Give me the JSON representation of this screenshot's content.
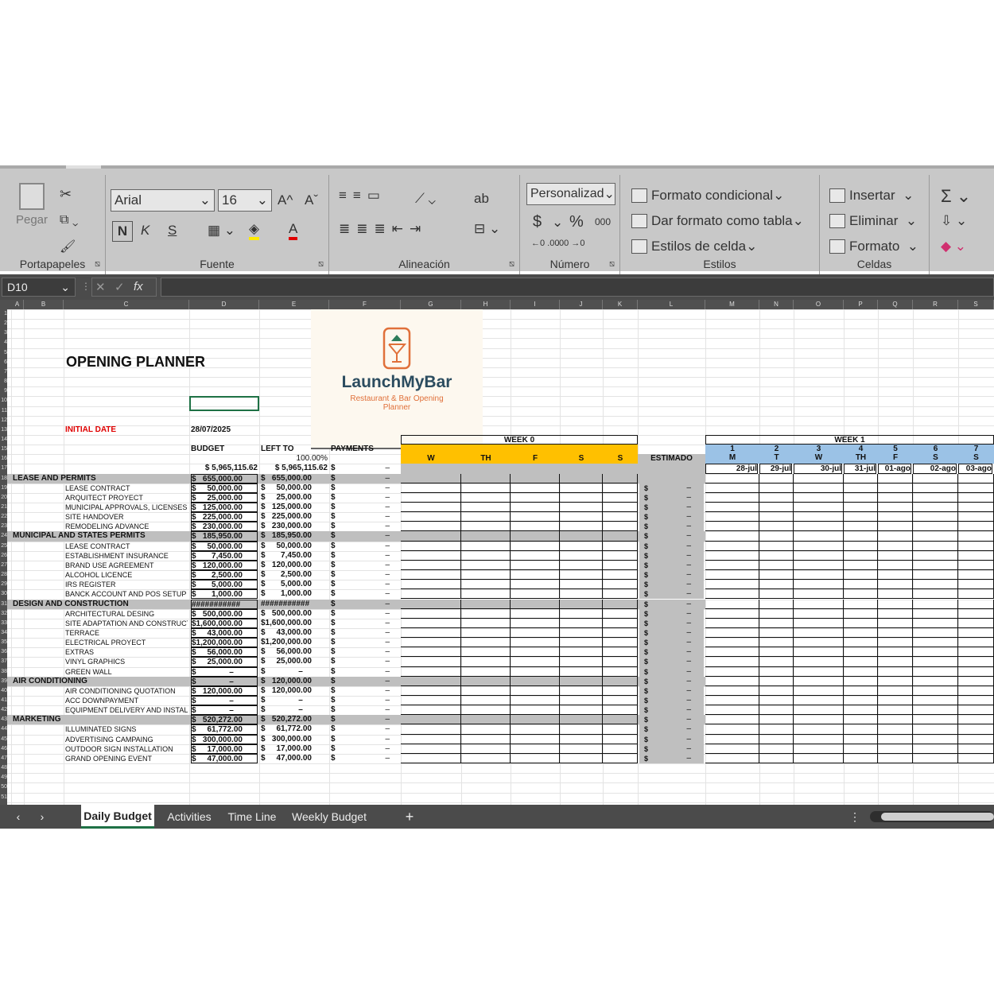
{
  "ribbon": {
    "clipboard": {
      "paste_label": "Pegar",
      "group_label": "Portapapeles"
    },
    "font": {
      "family": "Arial",
      "size": "16",
      "bold": "N",
      "italic": "K",
      "underline": "S",
      "group_label": "Fuente",
      "grow": "A^",
      "shrink": "Aˇ"
    },
    "alignment": {
      "group_label": "Alineación"
    },
    "number": {
      "format": "Personalizad",
      "currency": "$",
      "percent": "%",
      "thousands": "000",
      "inc_dec": "←0 .00",
      "dec_dec": ".00 →0",
      "group_label": "Número"
    },
    "styles": {
      "conditional": "Formato condicional",
      "as_table": "Dar formato como tabla",
      "cell_styles": "Estilos de celda",
      "group_label": "Estilos"
    },
    "cells": {
      "insert": "Insertar",
      "delete": "Eliminar",
      "format": "Formato",
      "group_label": "Celdas"
    }
  },
  "formula_bar": {
    "name_box": "D10",
    "fx": "fx",
    "value": ""
  },
  "columns": [
    "A",
    "B",
    "C",
    "D",
    "E",
    "F",
    "G",
    "H",
    "I",
    "J",
    "K",
    "L",
    "M",
    "N",
    "O",
    "P",
    "Q",
    "R",
    "S"
  ],
  "sheet": {
    "title": "OPENING PLANNER",
    "logo": {
      "name": "LaunchMyBar",
      "tagline": "Restaurant & Bar Opening Planner"
    },
    "initial_date_label": "INITIAL DATE",
    "initial_date": "28/07/2025",
    "headers": {
      "budget": "BUDGET",
      "left_to": "LEFT TO",
      "payments": "PAYMENTS",
      "percent": "100.00%",
      "estimado": "ESTIMADO"
    },
    "totals": {
      "budget": "$ 5,965,115.62",
      "left": "$ 5,965,115.62",
      "pay": "$",
      "dash": "–"
    },
    "week0": {
      "label": "WEEK 0",
      "days": [
        "W",
        "TH",
        "F",
        "S",
        "S"
      ]
    },
    "week1": {
      "label": "WEEK 1",
      "nums": [
        "1",
        "2",
        "3",
        "4",
        "5",
        "6",
        "7"
      ],
      "days": [
        "M",
        "T",
        "W",
        "TH",
        "F",
        "S",
        "S"
      ],
      "dates": [
        "28-jul",
        "29-jul",
        "30-jul",
        "31-jul",
        "01-ago",
        "02-ago",
        "03-ago"
      ]
    },
    "rows": [
      {
        "label": "LEASE AND PERMITS",
        "budget": "$   655,000.00",
        "left": "$   655,000.00",
        "cat": true
      },
      {
        "label": "LEASE CONTRACT",
        "budget": "$     50,000.00",
        "left": "$     50,000.00"
      },
      {
        "label": "ARQUITECT PROYECT",
        "budget": "$     25,000.00",
        "left": "$     25,000.00"
      },
      {
        "label": "MUNICIPAL APPROVALS, LICENSES",
        "budget": "$   125,000.00",
        "left": "$   125,000.00"
      },
      {
        "label": "SITE HANDOVER",
        "budget": "$   225,000.00",
        "left": "$   225,000.00"
      },
      {
        "label": "REMODELING ADVANCE",
        "budget": "$   230,000.00",
        "left": "$   230,000.00"
      },
      {
        "label": "MUNICIPAL AND STATES PERMITS",
        "budget": "$   185,950.00",
        "left": "$   185,950.00",
        "cat": true
      },
      {
        "label": "LEASE CONTRACT",
        "budget": "$     50,000.00",
        "left": "$     50,000.00"
      },
      {
        "label": "ESTABLISHMENT INSURANCE",
        "budget": "$       7,450.00",
        "left": "$       7,450.00"
      },
      {
        "label": "BRAND USE AGREEMENT",
        "budget": "$   120,000.00",
        "left": "$   120,000.00"
      },
      {
        "label": "ALCOHOL LICENCE",
        "budget": "$       2,500.00",
        "left": "$       2,500.00"
      },
      {
        "label": "IRS REGISTER",
        "budget": "$       5,000.00",
        "left": "$       5,000.00"
      },
      {
        "label": "BANCK ACCOUNT AND POS SETUP",
        "budget": "$       1,000.00",
        "left": "$       1,000.00"
      },
      {
        "label": "DESIGN AND CONSTRUCTION",
        "budget": "###########",
        "left": "###########",
        "cat": true
      },
      {
        "label": "ARCHITECTURAL DESING",
        "budget": "$   500,000.00",
        "left": "$   500,000.00"
      },
      {
        "label": "SITE ADAPTATION AND CONSTRUCTION",
        "budget": "$1,600,000.00",
        "left": "$1,600,000.00"
      },
      {
        "label": "TERRACE",
        "budget": "$     43,000.00",
        "left": "$     43,000.00"
      },
      {
        "label": "ELECTRICAL PROYECT",
        "budget": "$1,200,000.00",
        "left": "$1,200,000.00"
      },
      {
        "label": "EXTRAS",
        "budget": "$     56,000.00",
        "left": "$     56,000.00"
      },
      {
        "label": "VINYL GRAPHICS",
        "budget": "$     25,000.00",
        "left": "$     25,000.00"
      },
      {
        "label": "GREEN WALL",
        "budget": "$               –",
        "left": "$               –"
      },
      {
        "label": "AIR CONDITIONING",
        "budget": "$               –",
        "left": "$   120,000.00",
        "cat": true
      },
      {
        "label": "AIR CONDITIONING QUOTATION",
        "budget": "$   120,000.00",
        "left": "$   120,000.00"
      },
      {
        "label": "ACC DOWNPAYMENT",
        "budget": "$               –",
        "left": "$               –"
      },
      {
        "label": "EQUIPMENT DELIVERY AND INSTALATION",
        "budget": "$               –",
        "left": "$               –"
      },
      {
        "label": "MARKETING",
        "budget": "$   520,272.00",
        "left": "$   520,272.00",
        "cat": true
      },
      {
        "label": "ILLUMINATED SIGNS",
        "budget": "$     61,772.00",
        "left": "$     61,772.00"
      },
      {
        "label": "ADVERTISING CAMPAING",
        "budget": "$   300,000.00",
        "left": "$   300,000.00"
      },
      {
        "label": "OUTDOOR SIGN INSTALLATION",
        "budget": "$     17,000.00",
        "left": "$     17,000.00"
      },
      {
        "label": "GRAND OPENING EVENT",
        "budget": "$     47,000.00",
        "left": "$     47,000.00"
      }
    ],
    "pay_symbol": "$",
    "dash": "–"
  },
  "tabs": [
    "Daily Budget",
    "Activities",
    "Time Line",
    "Weekly Budget"
  ],
  "add_sheet": "+",
  "colors": {
    "week0": "#ffc000",
    "week1": "#9bc2e6",
    "category": "#bfbfbf",
    "red_text": "#e00000",
    "active_tab_underline": "#1e7145"
  }
}
